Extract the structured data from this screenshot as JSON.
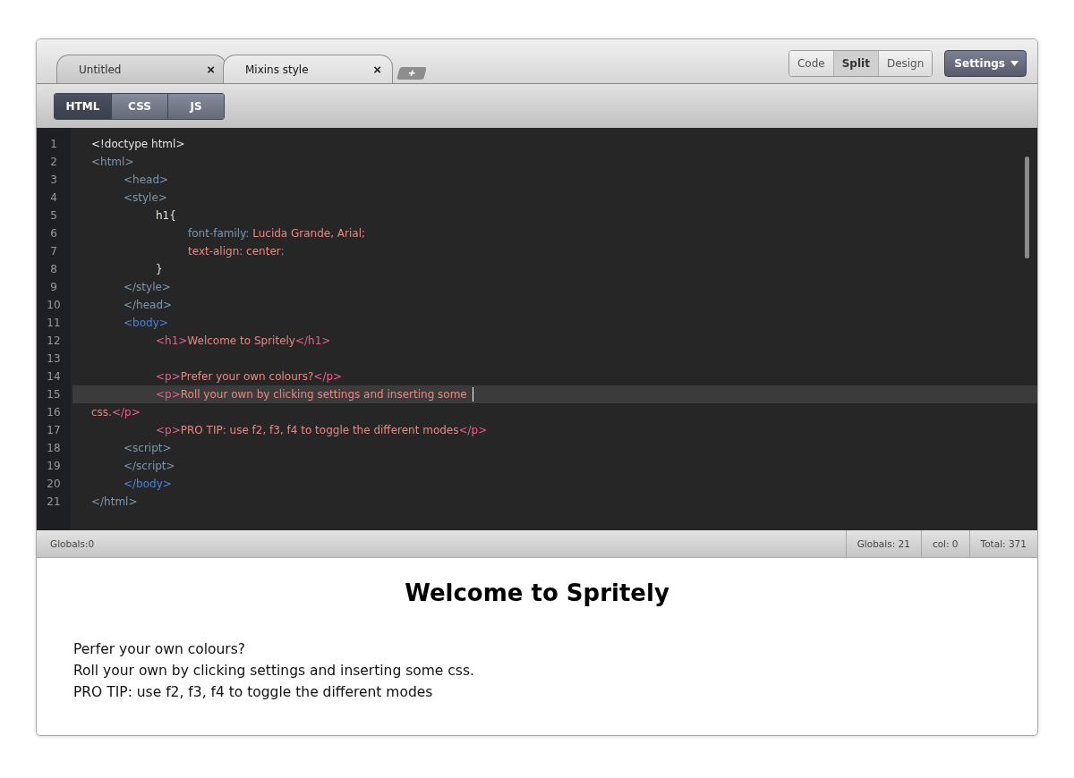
{
  "tabs": [
    {
      "label": "Untitled",
      "close": "×",
      "selected": false
    },
    {
      "label": "Mixins style",
      "close": "×",
      "selected": true
    }
  ],
  "new_tab": "+",
  "view_modes": [
    {
      "label": "Code",
      "selected": false
    },
    {
      "label": "Split",
      "selected": true
    },
    {
      "label": "Design",
      "selected": false
    }
  ],
  "settings_button": "Settings",
  "language_tabs": [
    {
      "label": "HTML",
      "selected": true
    },
    {
      "label": "CSS",
      "selected": false
    },
    {
      "label": "JS",
      "selected": false
    }
  ],
  "code_lines": [
    {
      "number": "1",
      "current": false,
      "tokens": [
        {
          "kind": "plain",
          "text": "<!doctype html>"
        }
      ]
    },
    {
      "number": "2",
      "current": false,
      "tokens": [
        {
          "kind": "tag",
          "text": "<html>"
        }
      ]
    },
    {
      "number": "3",
      "current": false,
      "tokens": [
        {
          "kind": "tag",
          "text": "\t<head>"
        }
      ]
    },
    {
      "number": "4",
      "current": false,
      "tokens": [
        {
          "kind": "tag",
          "text": "\t<style>"
        }
      ]
    },
    {
      "number": "5",
      "current": false,
      "tokens": [
        {
          "kind": "plain",
          "text": "\t\th1{"
        }
      ]
    },
    {
      "number": "6",
      "current": false,
      "tokens": [
        {
          "kind": "tag",
          "text": "\t\t\tfont-family:"
        },
        {
          "kind": "value",
          "text": " Lucida Grande, Arial;"
        }
      ]
    },
    {
      "number": "7",
      "current": false,
      "tokens": [
        {
          "kind": "value",
          "text": "\t\t\ttext-align: center"
        },
        {
          "kind": "blue",
          "text": ";"
        }
      ]
    },
    {
      "number": "8",
      "current": false,
      "tokens": [
        {
          "kind": "plain",
          "text": "\t\t}"
        }
      ]
    },
    {
      "number": "9",
      "current": false,
      "tokens": [
        {
          "kind": "tag",
          "text": "\t</style>"
        }
      ]
    },
    {
      "number": "10",
      "current": false,
      "tokens": [
        {
          "kind": "tag",
          "text": "\t</head>"
        }
      ]
    },
    {
      "number": "11",
      "current": false,
      "tokens": [
        {
          "kind": "blue",
          "text": "\t<body>"
        }
      ]
    },
    {
      "number": "12",
      "current": false,
      "tokens": [
        {
          "kind": "pink",
          "text": "\t\t<h1>"
        },
        {
          "kind": "value",
          "text": "Welcome to Spritely"
        },
        {
          "kind": "pink",
          "text": "</h1>"
        }
      ]
    },
    {
      "number": "13",
      "current": false
    },
    {
      "number": "14",
      "current": false,
      "tokens": [
        {
          "kind": "pink",
          "text": "\t\t<p>"
        },
        {
          "kind": "value",
          "text": "Prefer your own colours?"
        },
        {
          "kind": "pink",
          "text": "</p>"
        }
      ]
    },
    {
      "number": "15",
      "current": true,
      "tokens": [
        {
          "kind": "pink",
          "text": "\t\t<p>"
        },
        {
          "kind": "value",
          "text": "Roll your own by clicking settings and inserting some "
        }
      ]
    },
    {
      "number": "16",
      "current": false,
      "tokens": [
        {
          "kind": "value",
          "text": "css."
        },
        {
          "kind": "pink",
          "text": "</p>"
        }
      ]
    },
    {
      "number": "17",
      "current": false,
      "tokens": [
        {
          "kind": "pink",
          "text": "\t\t<p>"
        },
        {
          "kind": "value",
          "text": "PRO TIP: use f2, f3, f4 to toggle the different modes"
        },
        {
          "kind": "pink",
          "text": "</p>"
        }
      ]
    },
    {
      "number": "18",
      "current": false,
      "tokens": [
        {
          "kind": "tag",
          "text": "\t<script>"
        }
      ]
    },
    {
      "number": "19",
      "current": false,
      "tokens": [
        {
          "kind": "tag",
          "text": "\t</script>"
        }
      ]
    },
    {
      "number": "20",
      "current": false,
      "tokens": [
        {
          "kind": "blue",
          "text": "\t</body>"
        }
      ]
    },
    {
      "number": "21",
      "current": false,
      "tokens": [
        {
          "kind": "tag",
          "text": "</html>"
        }
      ]
    }
  ],
  "status_bar": {
    "left": "Globals:0",
    "right": [
      "Globals:  21",
      "col:  0",
      "Total:  371"
    ]
  },
  "preview": {
    "heading": "Welcome to Spritely",
    "paragraphs": [
      "Perfer your own colours?",
      "Roll your own by clicking settings and inserting some css.",
      "PRO TIP: use f2, f3, f4 to toggle the different modes"
    ]
  }
}
